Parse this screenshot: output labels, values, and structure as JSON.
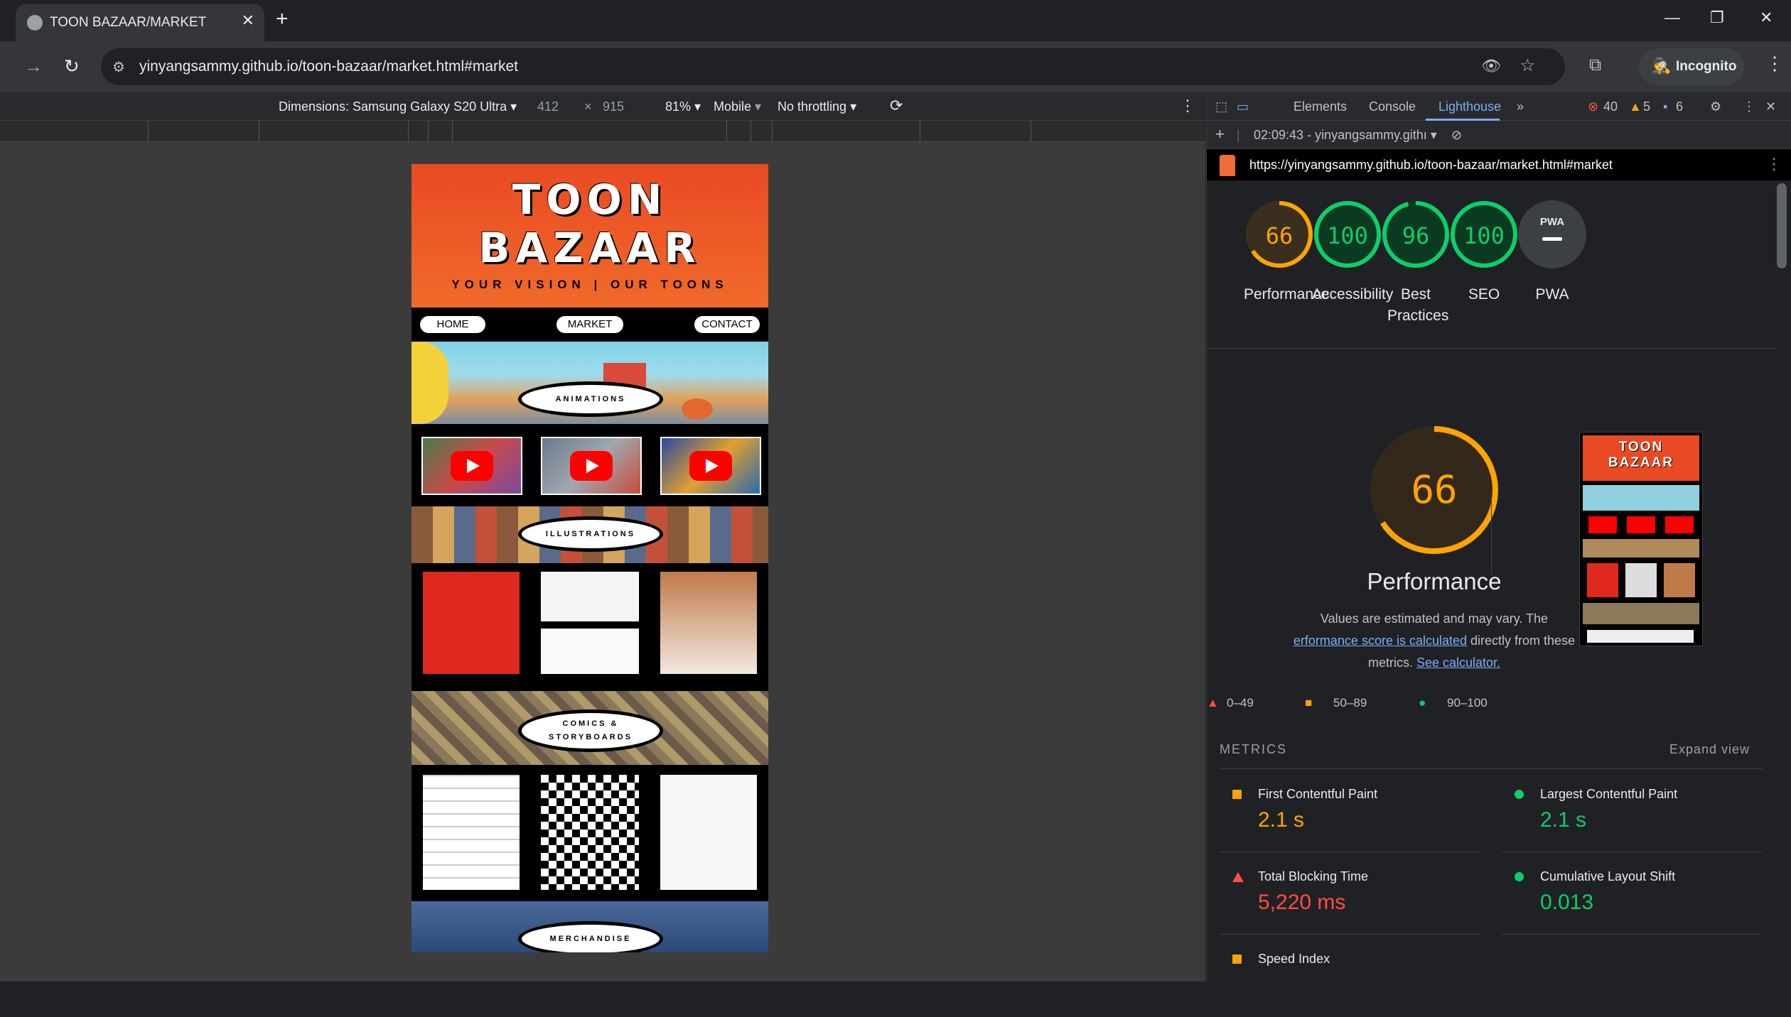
{
  "browser": {
    "tab_title": "TOON BAZAAR/MARKET",
    "url": "yinyangsammy.github.io/toon-bazaar/market.html#market",
    "incognito_label": "Incognito"
  },
  "device_toolbar": {
    "dimensions_label": "Dimensions: Samsung Galaxy S20 Ultra",
    "width": "412",
    "times": "×",
    "height": "915",
    "zoom": "81%",
    "mode": "Mobile",
    "throttling": "No throttling"
  },
  "site": {
    "title_line1": "TOON",
    "title_line2": "BAZAAR",
    "tagline": "YOUR VISION | OUR TOONS",
    "nav": [
      "HOME",
      "MARKET",
      "CONTACT"
    ],
    "sections": {
      "animations": "ANIMATIONS",
      "illustrations": "ILLUSTRATIONS",
      "comics_line1": "COMICS &",
      "comics_line2": "STORYBOARDS",
      "merch": "MERCHANDISE"
    }
  },
  "devtools": {
    "tabs": [
      "Elements",
      "Console",
      "Lighthouse"
    ],
    "errors": "40",
    "warnings": "5",
    "messages": "6",
    "report_time": "02:09:43 - yinyangsammy.githı",
    "report_url": "https://yinyangsammy.github.io/toon-bazaar/market.html#market",
    "scores": [
      {
        "label": "Performance",
        "value": 66,
        "color": "#ffa400"
      },
      {
        "label": "Accessibility",
        "value": 100,
        "color": "#0cce6b"
      },
      {
        "label": "Best Practices",
        "value": 96,
        "color": "#0cce6b"
      },
      {
        "label": "SEO",
        "value": 100,
        "color": "#0cce6b"
      },
      {
        "label": "PWA",
        "value": null,
        "color": "#9aa0a6"
      }
    ],
    "pwa_badge": "PWA",
    "big_score": "66",
    "big_title": "Performance",
    "desc_1": "Values are estimated and may vary. The",
    "desc_link1": "erformance score is calculated",
    "desc_2": "directly from these",
    "desc_3": "metrics.",
    "desc_link2": "See calculator.",
    "legend": [
      "0–49",
      "50–89",
      "90–100"
    ],
    "metrics_heading": "METRICS",
    "expand_view": "Expand view",
    "metrics": [
      {
        "name": "First Contentful Paint",
        "value": "2.1 s",
        "status": "average",
        "color": "#ffa400"
      },
      {
        "name": "Largest Contentful Paint",
        "value": "2.1 s",
        "status": "pass",
        "color": "#0cce6b"
      },
      {
        "name": "Total Blocking Time",
        "value": "5,220 ms",
        "status": "fail",
        "color": "#ff4e42"
      },
      {
        "name": "Cumulative Layout Shift",
        "value": "0.013",
        "status": "pass",
        "color": "#0cce6b"
      },
      {
        "name": "Speed Index",
        "value": "",
        "status": "average",
        "color": "#ffa400"
      }
    ],
    "preview": {
      "title_line1": "TOON",
      "title_line2": "BAZAAR"
    }
  }
}
